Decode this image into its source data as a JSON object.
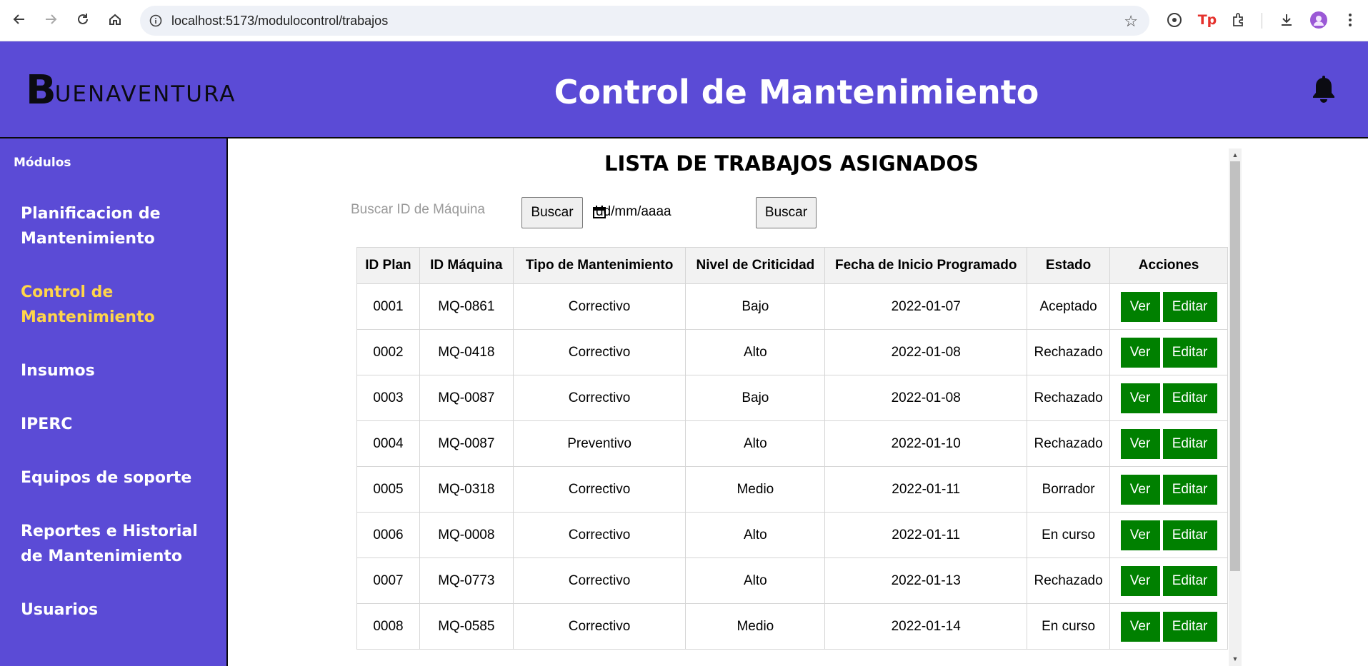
{
  "browser": {
    "url": "localhost:5173/modulocontrol/trabajos"
  },
  "header": {
    "logo_initial": "B",
    "logo_rest": "UENAVENTURA",
    "title": "Control de Mantenimiento"
  },
  "sidebar": {
    "heading": "Módulos",
    "items": [
      {
        "label": "Planificacion de Mantenimiento",
        "active": false
      },
      {
        "label": "Control de Mantenimiento",
        "active": true
      },
      {
        "label": "Insumos",
        "active": false
      },
      {
        "label": "IPERC",
        "active": false
      },
      {
        "label": "Equipos de soporte",
        "active": false
      },
      {
        "label": "Reportes e Historial de Mantenimiento",
        "active": false
      },
      {
        "label": "Usuarios",
        "active": false
      }
    ],
    "accent_color": "#ffd54a",
    "background_color": "#5b4bd6"
  },
  "main": {
    "title": "LISTA DE TRABAJOS ASIGNADOS",
    "search_placeholder": "Buscar ID de Máquina",
    "search_button": "Buscar",
    "date_placeholder": "dd/mm/aaaa",
    "date_button": "Buscar",
    "columns": [
      "ID Plan",
      "ID Máquina",
      "Tipo de Mantenimiento",
      "Nivel de Criticidad",
      "Fecha de Inicio Programado",
      "Estado",
      "Acciones"
    ],
    "rows": [
      [
        "0001",
        "MQ-0861",
        "Correctivo",
        "Bajo",
        "2022-01-07",
        "Aceptado"
      ],
      [
        "0002",
        "MQ-0418",
        "Correctivo",
        "Alto",
        "2022-01-08",
        "Rechazado"
      ],
      [
        "0003",
        "MQ-0087",
        "Correctivo",
        "Bajo",
        "2022-01-08",
        "Rechazado"
      ],
      [
        "0004",
        "MQ-0087",
        "Preventivo",
        "Alto",
        "2022-01-10",
        "Rechazado"
      ],
      [
        "0005",
        "MQ-0318",
        "Correctivo",
        "Medio",
        "2022-01-11",
        "Borrador"
      ],
      [
        "0006",
        "MQ-0008",
        "Correctivo",
        "Alto",
        "2022-01-11",
        "En curso"
      ],
      [
        "0007",
        "MQ-0773",
        "Correctivo",
        "Alto",
        "2022-01-13",
        "Rechazado"
      ],
      [
        "0008",
        "MQ-0585",
        "Correctivo",
        "Medio",
        "2022-01-14",
        "En curso"
      ]
    ],
    "action_view": "Ver",
    "action_edit": "Editar",
    "action_color": "#008000"
  }
}
